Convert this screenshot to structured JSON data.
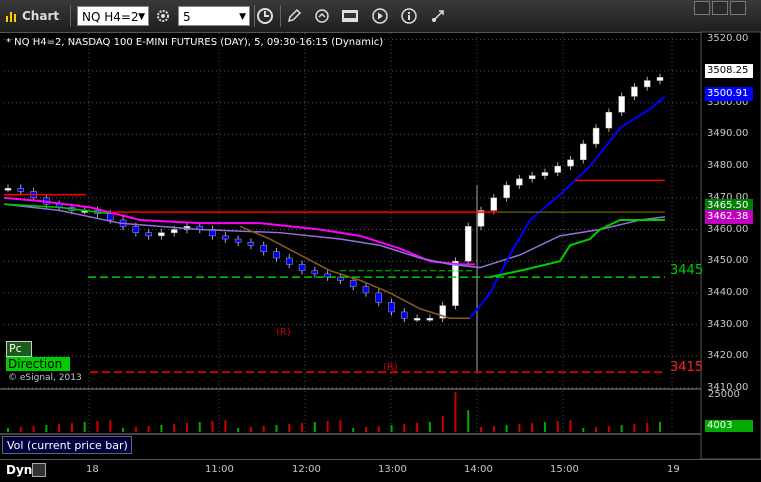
{
  "window": {
    "title": "Chart"
  },
  "toolbar": {
    "symbol_value": "NQ H4=2",
    "interval_value": "5"
  },
  "legend": {
    "text": "* NQ H4=2, NASDAQ 100 E-MINI FUTURES (DAY), 5, 09:30-16:15 (Dynamic)"
  },
  "price_axis": {
    "ticks": [
      "3520.00",
      "3510.00",
      "3500.00",
      "3490.00",
      "3480.00",
      "3470.00",
      "3460.00",
      "3450.00",
      "3440.00",
      "3430.00",
      "3420.00",
      "3410.00"
    ],
    "tags": [
      {
        "label": "3508.25",
        "bg": "#ffffff",
        "fg": "#000000"
      },
      {
        "label": "3500.91",
        "bg": "#0000ff",
        "fg": "#ffffff"
      },
      {
        "label": "3465.50",
        "bg": "#008000",
        "fg": "#ffffff"
      },
      {
        "label": "3462.38",
        "bg": "#c000c0",
        "fg": "#ffffff"
      }
    ]
  },
  "levels": {
    "green_label": "3445",
    "red_label": "3415"
  },
  "annotations": {
    "r1": "(R)",
    "r2": "(R)"
  },
  "indicators": {
    "pc_label": "Pc",
    "direction_label": "Direction",
    "watermark": "© eSignal, 2013"
  },
  "volume": {
    "label": "Vol (current price bar)",
    "ticks": [
      "25000"
    ],
    "current_tag": "4003"
  },
  "time_axis": {
    "ticks": [
      "18",
      "11:00",
      "12:00",
      "13:00",
      "14:00",
      "15:00",
      "19"
    ],
    "mode": "Dyn"
  },
  "colors": {
    "background": "#000000",
    "up_candle": "#ffffff",
    "down_candle": "#0000ff",
    "sma_blue": "#0000ff",
    "magenta_line": "#ff00ff",
    "purple_line": "#9370db",
    "brown_line": "#8b5a2b",
    "green_line": "#00cc00",
    "red_level": "#ff0000",
    "green_level": "#00cc00"
  },
  "chart_data": {
    "type": "line",
    "title": "NQ H4=2, NASDAQ 100 E-MINI FUTURES (DAY), 5, 09:30-16:15 (Dynamic)",
    "ylim": [
      3410,
      3522
    ],
    "last_price": 3508.25,
    "series": [
      {
        "values": [
          3473,
          3472,
          3470,
          3468,
          3467,
          3466,
          3466,
          3465,
          3463,
          3461,
          3459,
          3458,
          3459,
          3460,
          3461,
          3460,
          3458,
          3457,
          3456,
          3455,
          3453,
          3451,
          3449,
          3447,
          3446,
          3445,
          3444,
          3442,
          3440,
          3437,
          3434,
          3432,
          3432,
          3432,
          3436,
          3450,
          3461,
          3466,
          3470,
          3474,
          3476,
          3477,
          3478,
          3480,
          3482,
          3487,
          3492,
          3497,
          3502,
          3505,
          3507,
          3508
        ]
      }
    ]
  }
}
